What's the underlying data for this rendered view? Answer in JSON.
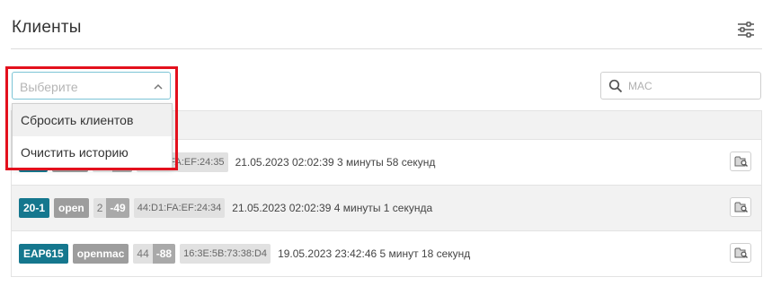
{
  "header": {
    "title": "Клиенты"
  },
  "filter": {
    "placeholder": "Выберите",
    "options": [
      "Сбросить клиентов",
      "Очистить историю"
    ]
  },
  "search": {
    "placeholder": "MAC"
  },
  "rows": [
    {
      "ap": "",
      "ssid": "",
      "ch": "",
      "signal": "",
      "mac": "44:D1:FA:EF:24:35",
      "time": "21.05.2023 02:02:39 3 минуты 58 секунд"
    },
    {
      "ap": "20-1",
      "ssid": "open",
      "ch": "2",
      "signal": "-49",
      "mac": "44:D1:FA:EF:24:34",
      "time": "21.05.2023 02:02:39 4 минуты 1 секунда"
    },
    {
      "ap": "EAP615",
      "ssid": "openmac",
      "ch": "44",
      "signal": "-88",
      "mac": "16:3E:5B:73:38:D4",
      "time": "19.05.2023 23:42:46 5 минут 18 секунд"
    }
  ],
  "icons": {
    "settings": "sliders-icon",
    "chevron": "chevron-up-icon",
    "search": "magnifier-icon",
    "row_action": "folder-search-icon"
  },
  "colors": {
    "ap_badge": "#15778e",
    "ssid_badge": "#9d9d9d",
    "highlight_frame": "#e3101d"
  }
}
